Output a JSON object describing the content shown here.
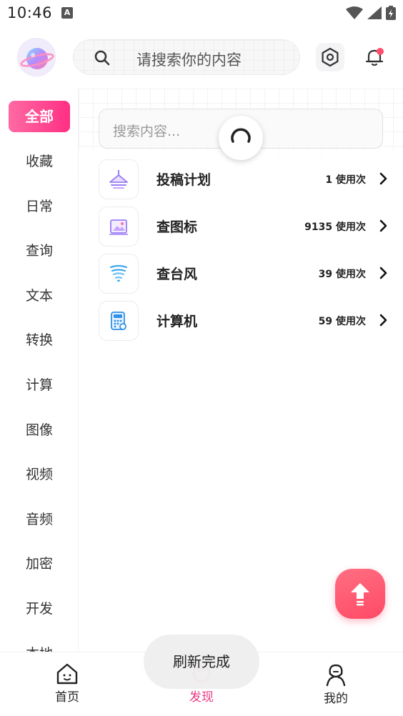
{
  "status_bar": {
    "time": "10:46",
    "a_badge": "A"
  },
  "header": {
    "search_placeholder": "请搜索你的内容",
    "icons": [
      "planet-logo-icon",
      "search-icon",
      "settings-hexagon-icon",
      "bell-icon"
    ]
  },
  "sidebar": {
    "items": [
      {
        "label": "全部",
        "active": true
      },
      {
        "label": "收藏"
      },
      {
        "label": "日常"
      },
      {
        "label": "查询"
      },
      {
        "label": "文本"
      },
      {
        "label": "转换"
      },
      {
        "label": "计算"
      },
      {
        "label": "图像"
      },
      {
        "label": "视频"
      },
      {
        "label": "音频"
      },
      {
        "label": "加密"
      },
      {
        "label": "开发"
      },
      {
        "label": "本地"
      }
    ]
  },
  "content": {
    "search_placeholder": "搜索内容...",
    "tools": [
      {
        "name": "投稿计划",
        "count": "1 使用次",
        "icon": "submission-icon"
      },
      {
        "name": "查图标",
        "count": "9135 使用次",
        "icon": "image-search-icon"
      },
      {
        "name": "查台风",
        "count": "39 使用次",
        "icon": "typhoon-icon"
      },
      {
        "name": "计算机",
        "count": "59 使用次",
        "icon": "calculator-icon"
      }
    ]
  },
  "bottom_nav": {
    "items": [
      {
        "label": "首页",
        "active": false
      },
      {
        "label": "发现",
        "active": true
      },
      {
        "label": "我的",
        "active": false
      }
    ]
  },
  "toast": {
    "text": "刷新完成"
  },
  "colors": {
    "accent": "#ff2f84",
    "fab": "#ff5a70",
    "active_nav": "#e93a86"
  }
}
